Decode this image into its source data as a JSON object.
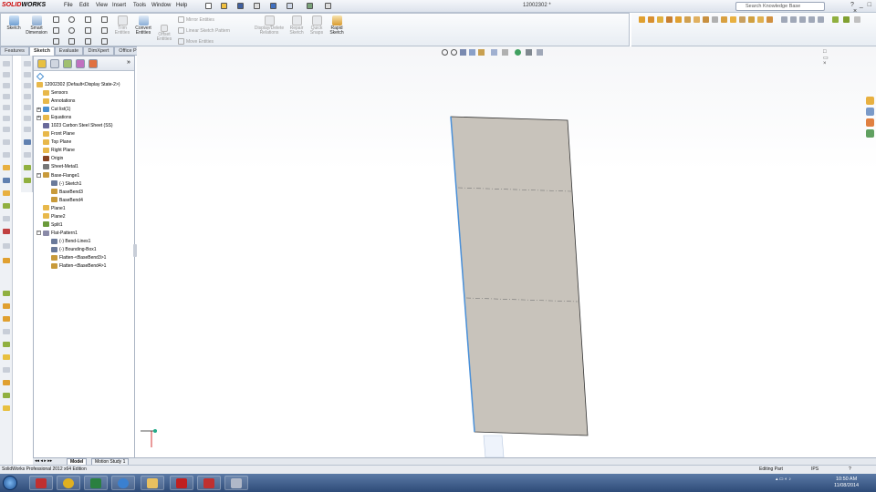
{
  "app": {
    "logo_solid": "SOLID",
    "logo_works": "WORKS",
    "document_title": "12002302 *",
    "search_placeholder": "Search Knowledge Base"
  },
  "menu": [
    "File",
    "Edit",
    "View",
    "Insert",
    "Tools",
    "Window",
    "Help"
  ],
  "commands": {
    "sketch": "Sketch",
    "smart_dimension": [
      "Smart",
      "Dimension"
    ],
    "trim": [
      "Trim",
      "Entities"
    ],
    "convert": [
      "Convert",
      "Entities"
    ],
    "offset": [
      "Offset",
      "Entities"
    ],
    "mirror": "Mirror Entities",
    "linear_pattern": "Linear Sketch Pattern",
    "move": "Move Entities",
    "display_delete": [
      "Display/Delete",
      "Relations"
    ],
    "repair": [
      "Repair",
      "Sketch"
    ],
    "quick_snaps": [
      "Quick",
      "Snaps"
    ],
    "rapid_sketch": [
      "Rapid",
      "Sketch"
    ]
  },
  "tabs": [
    "Features",
    "Sketch",
    "Evaluate",
    "DimXpert",
    "Office Products"
  ],
  "active_tab": "Sketch",
  "tree": {
    "root": "12002302  (Default<Display State-2>)",
    "items": [
      {
        "label": "Sensors",
        "level": 1,
        "color": "#e8b84a"
      },
      {
        "label": "Annotations",
        "level": 1,
        "color": "#e8b84a"
      },
      {
        "label": "Cut list(1)",
        "level": 1,
        "color": "#4a8fd1"
      },
      {
        "label": "Equations",
        "level": 1,
        "color": "#e8b84a"
      },
      {
        "label": "1023 Carbon Steel Sheet (SS)",
        "level": 1,
        "color": "#6a6a9a"
      },
      {
        "label": "Front Plane",
        "level": 1,
        "color": "#e8b84a"
      },
      {
        "label": "Top Plane",
        "level": 1,
        "color": "#e8b84a"
      },
      {
        "label": "Right Plane",
        "level": 1,
        "color": "#e8b84a"
      },
      {
        "label": "Origin",
        "level": 1,
        "color": "#884422"
      },
      {
        "label": "Sheet-Metal1",
        "level": 1,
        "color": "#777777"
      },
      {
        "label": "Base-Flange1",
        "level": 1,
        "color": "#c89a3a"
      },
      {
        "label": "(-) Sketch1",
        "level": 2,
        "color": "#6a7a9a"
      },
      {
        "label": "BaseBend3",
        "level": 2,
        "color": "#c89a3a"
      },
      {
        "label": "BaseBend4",
        "level": 2,
        "color": "#c89a3a"
      },
      {
        "label": "Plane1",
        "level": 1,
        "color": "#e8b84a"
      },
      {
        "label": "Plane2",
        "level": 1,
        "color": "#e8b84a"
      },
      {
        "label": "Split1",
        "level": 1,
        "color": "#6a9a3a"
      },
      {
        "label": "Flat-Pattern1",
        "level": 1,
        "color": "#8a8aa8"
      },
      {
        "label": "(-) Bend-Lines1",
        "level": 2,
        "color": "#6a7a9a"
      },
      {
        "label": "(-) Bounding-Box1",
        "level": 2,
        "color": "#6a7a9a"
      },
      {
        "label": "Flatten-<BaseBend3>1",
        "level": 2,
        "color": "#c89a3a"
      },
      {
        "label": "Flatten-<BaseBend4>1",
        "level": 2,
        "color": "#c89a3a"
      }
    ]
  },
  "bottom_tabs": [
    "Model",
    "Motion Study 1"
  ],
  "status": {
    "left": "SolidWorks Professional 2012 x64 Edition",
    "mode": "Editing Part",
    "units": "IPS"
  },
  "clock": {
    "time": "10:50 AM",
    "date": "11/08/2014"
  },
  "colors": {
    "part_face": "#c8c3bb",
    "edge_highlight": "#4a90d9",
    "accent": "#c00000"
  }
}
